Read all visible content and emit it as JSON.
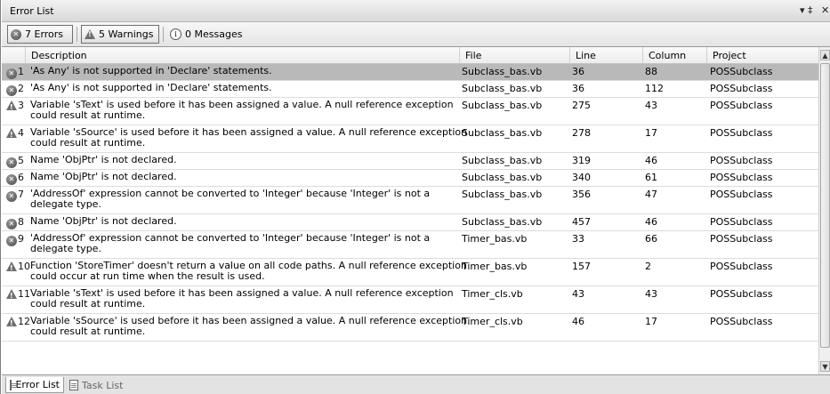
{
  "window": {
    "title": "Error List",
    "pin_glyph": "▾ ‡",
    "close_glyph": "✕"
  },
  "toolbar": {
    "errors_label": "7 Errors",
    "warnings_label": "5 Warnings",
    "messages_label": "0 Messages",
    "errors_icon": "error-icon",
    "warnings_icon": "warning-icon",
    "messages_icon": "info-icon"
  },
  "columns": {
    "description": "Description",
    "file": "File",
    "line": "Line",
    "column": "Column",
    "project": "Project"
  },
  "rows": [
    {
      "type": "error",
      "num": "1",
      "description": "'As Any' is not supported in 'Declare' statements.",
      "file": "Subclass_bas.vb",
      "line": "36",
      "column": "88",
      "project": "POSSubclass"
    },
    {
      "type": "error",
      "num": "2",
      "description": "'As Any' is not supported in 'Declare' statements.",
      "file": "Subclass_bas.vb",
      "line": "36",
      "column": "112",
      "project": "POSSubclass"
    },
    {
      "type": "warning",
      "num": "3",
      "description": "Variable 'sText' is used before it has been assigned a value. A null reference exception could result at runtime.",
      "file": "Subclass_bas.vb",
      "line": "275",
      "column": "43",
      "project": "POSSubclass"
    },
    {
      "type": "warning",
      "num": "4",
      "description": "Variable 'sSource' is used before it has been assigned a value. A null reference exception could result at runtime.",
      "file": "Subclass_bas.vb",
      "line": "278",
      "column": "17",
      "project": "POSSubclass"
    },
    {
      "type": "error",
      "num": "5",
      "description": "Name 'ObjPtr' is not declared.",
      "file": "Subclass_bas.vb",
      "line": "319",
      "column": "46",
      "project": "POSSubclass"
    },
    {
      "type": "error",
      "num": "6",
      "description": "Name 'ObjPtr' is not declared.",
      "file": "Subclass_bas.vb",
      "line": "340",
      "column": "61",
      "project": "POSSubclass"
    },
    {
      "type": "error",
      "num": "7",
      "description": "'AddressOf' expression cannot be converted to 'Integer' because 'Integer' is not a delegate type.",
      "file": "Subclass_bas.vb",
      "line": "356",
      "column": "47",
      "project": "POSSubclass"
    },
    {
      "type": "error",
      "num": "8",
      "description": "Name 'ObjPtr' is not declared.",
      "file": "Subclass_bas.vb",
      "line": "457",
      "column": "46",
      "project": "POSSubclass"
    },
    {
      "type": "error",
      "num": "9",
      "description": "'AddressOf' expression cannot be converted to 'Integer' because 'Integer' is not a delegate type.",
      "file": "Timer_bas.vb",
      "line": "33",
      "column": "66",
      "project": "POSSubclass"
    },
    {
      "type": "warning",
      "num": "10",
      "description": "Function 'StoreTimer' doesn't return a value on all code paths. A null reference exception could occur at run time when the result is used.",
      "file": "Timer_bas.vb",
      "line": "157",
      "column": "2",
      "project": "POSSubclass"
    },
    {
      "type": "warning",
      "num": "11",
      "description": "Variable 'sText' is used before it has been assigned a value. A null reference exception could result at runtime.",
      "file": "Timer_cls.vb",
      "line": "43",
      "column": "43",
      "project": "POSSubclass"
    },
    {
      "type": "warning",
      "num": "12",
      "description": "Variable 'sSource' is used before it has been assigned a value. A null reference exception could result at runtime.",
      "file": "Timer_cls.vb",
      "line": "46",
      "column": "17",
      "project": "POSSubclass"
    }
  ],
  "tabs": [
    {
      "label": "Error List",
      "icon": "error-list-icon",
      "active": true
    },
    {
      "label": "Task List",
      "icon": "task-list-icon",
      "active": false
    }
  ]
}
